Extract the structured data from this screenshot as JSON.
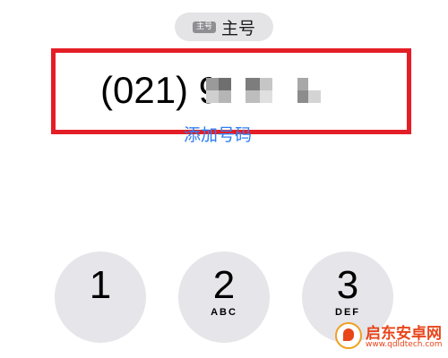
{
  "line_selector": {
    "badge_text": "主号",
    "label": "主号"
  },
  "number_display": {
    "area_code": "(021)",
    "visible_digit": "9",
    "redacted": true,
    "highlight_color": "#e41e26"
  },
  "add_number": {
    "label": "添加号码",
    "color": "#2f7ff5"
  },
  "keypad": {
    "keys": [
      {
        "digit": "1",
        "letters": ""
      },
      {
        "digit": "2",
        "letters": "ABC"
      },
      {
        "digit": "3",
        "letters": "DEF"
      }
    ]
  },
  "watermark": {
    "title": "启东安卓网",
    "url": "www.qdldtech.com"
  }
}
